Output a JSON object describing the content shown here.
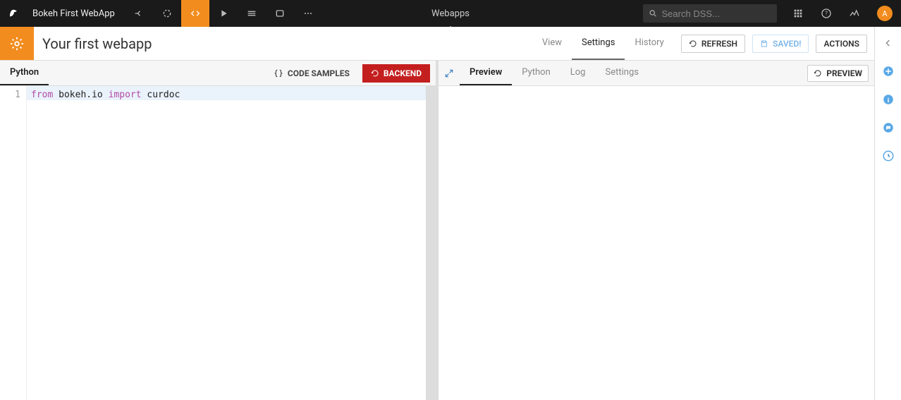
{
  "topbar": {
    "project_title": "Bokeh First WebApp",
    "breadcrumb": "Webapps",
    "search_placeholder": "Search DSS...",
    "avatar_letter": "A"
  },
  "header": {
    "page_title": "Your first webapp",
    "tabs": [
      {
        "label": "View",
        "active": false
      },
      {
        "label": "Settings",
        "active": true
      },
      {
        "label": "History",
        "active": false
      }
    ],
    "refresh_label": "REFRESH",
    "saved_label": "SAVED!",
    "actions_label": "ACTIONS"
  },
  "left_pane": {
    "tabs": [
      {
        "label": "Python",
        "active": true
      }
    ],
    "code_samples_label": "CODE SAMPLES",
    "backend_label": "BACKEND",
    "code": {
      "line_number": "1",
      "tokens": [
        "from",
        "bokeh.io",
        "import",
        "curdoc"
      ]
    }
  },
  "right_pane": {
    "tabs": [
      {
        "label": "Preview",
        "active": true
      },
      {
        "label": "Python",
        "active": false
      },
      {
        "label": "Log",
        "active": false
      },
      {
        "label": "Settings",
        "active": false
      }
    ],
    "preview_label": "PREVIEW"
  }
}
